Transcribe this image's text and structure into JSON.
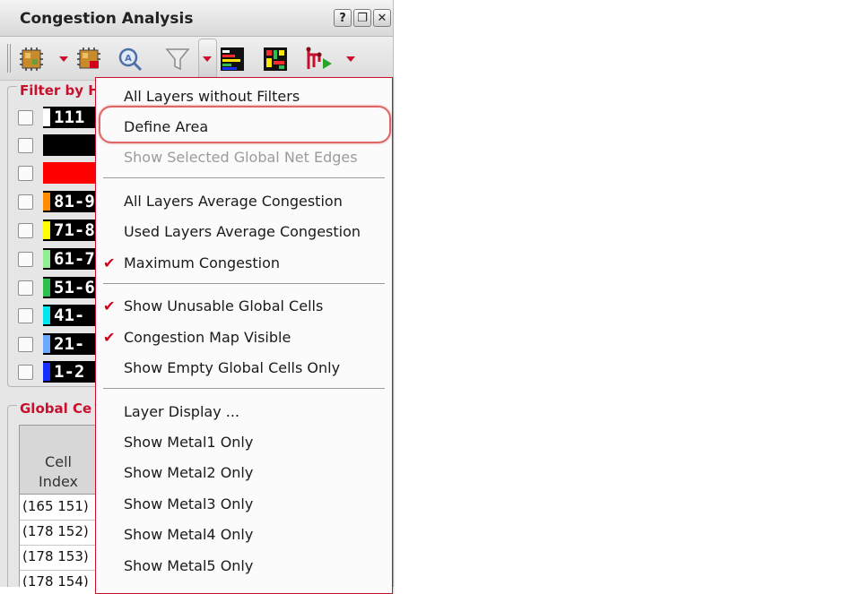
{
  "window": {
    "title": "Congestion Analysis",
    "buttons": [
      "?",
      "❐",
      "✕"
    ]
  },
  "filter_group": {
    "label": "Filter by H",
    "rows": [
      {
        "label": "111",
        "color": "#ffffff"
      },
      {
        "label": "",
        "color": "#000000"
      },
      {
        "label": "",
        "color": "#ff0000"
      },
      {
        "label": "81-9",
        "color": "#ff8c00"
      },
      {
        "label": "71-8",
        "color": "#ffff00"
      },
      {
        "label": "61-7",
        "color": "#90ee90"
      },
      {
        "label": "51-6",
        "color": "#2fbf4f"
      },
      {
        "label": "41-",
        "color": "#00e5ee"
      },
      {
        "label": "21-",
        "color": "#6aa8ff"
      },
      {
        "label": "1-2",
        "color": "#1530ff"
      }
    ]
  },
  "global_group": {
    "label": "Global Ce",
    "header_line1": "Cell",
    "header_line2": "Index",
    "rows": [
      "(165 151)",
      "(178 152)",
      "(178 153)",
      "(178 154)"
    ]
  },
  "menu": {
    "items": [
      {
        "label": "All Layers without Filters",
        "checked": false,
        "disabled": false
      },
      {
        "label": "Define Area",
        "checked": false,
        "disabled": false
      },
      {
        "label": "Show Selected Global Net Edges",
        "checked": false,
        "disabled": true
      },
      {
        "label": "All Layers Average Congestion",
        "checked": false,
        "disabled": false
      },
      {
        "label": "Used Layers Average Congestion",
        "checked": false,
        "disabled": false
      },
      {
        "label": "Maximum Congestion",
        "checked": true,
        "disabled": false
      },
      {
        "label": "Show Unusable Global Cells",
        "checked": true,
        "disabled": false
      },
      {
        "label": "Congestion Map Visible",
        "checked": true,
        "disabled": false
      },
      {
        "label": "Show Empty Global Cells Only",
        "checked": false,
        "disabled": false
      },
      {
        "label": "Layer Display ...",
        "checked": false,
        "disabled": false
      },
      {
        "label": "Show Metal1 Only",
        "checked": false,
        "disabled": false
      },
      {
        "label": "Show Metal2 Only",
        "checked": false,
        "disabled": false
      },
      {
        "label": "Show Metal3 Only",
        "checked": false,
        "disabled": false
      },
      {
        "label": "Show Metal4 Only",
        "checked": false,
        "disabled": false
      },
      {
        "label": "Show Metal5 Only",
        "checked": false,
        "disabled": false
      }
    ],
    "check_glyph": "✔"
  },
  "icons": [
    "congestion-map-icon",
    "congestion-map-stop-icon",
    "zoom-icon",
    "filter-icon",
    "histogram-icon",
    "layout-map-icon",
    "net-route-icon"
  ],
  "colors": {
    "accent": "#c8102e",
    "highlight_ring": "#e06666"
  }
}
